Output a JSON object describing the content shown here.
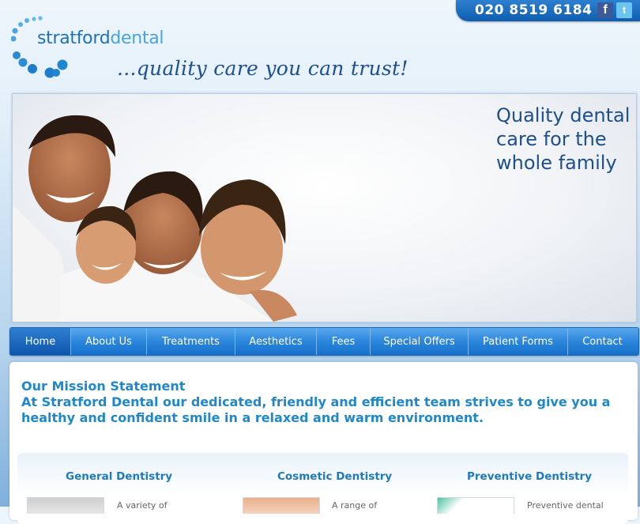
{
  "header": {
    "phone": "020 8519 6184",
    "social": [
      {
        "name": "facebook-icon",
        "glyph": "f"
      },
      {
        "name": "twitter-icon",
        "glyph": "t"
      }
    ],
    "brand_part1": "stratford",
    "brand_part2": "dental",
    "tagline": "...quality care you can trust!"
  },
  "hero": {
    "text": "Quality dental care for the whole family"
  },
  "nav": {
    "items": [
      "Home",
      "About Us",
      "Treatments",
      "Aesthetics",
      "Fees",
      "Special Offers",
      "Patient Forms",
      "Contact"
    ],
    "active": "Home"
  },
  "main": {
    "mission_title": "Our Mission Statement",
    "mission_text": "At Stratford Dental our dedicated, friendly and efficient team strives to give you a healthy and confident smile in a relaxed and warm environment.",
    "services": [
      {
        "title": "General Dentistry",
        "snippet": "A variety of"
      },
      {
        "title": "Cosmetic Dentistry",
        "snippet": "A range of"
      },
      {
        "title": "Preventive Dentistry",
        "snippet": "Preventive dental"
      }
    ]
  },
  "colors": {
    "nav_blue": "#2b86dc",
    "heading_blue": "#1f88cc",
    "tagline_navy": "#1d4f93"
  }
}
